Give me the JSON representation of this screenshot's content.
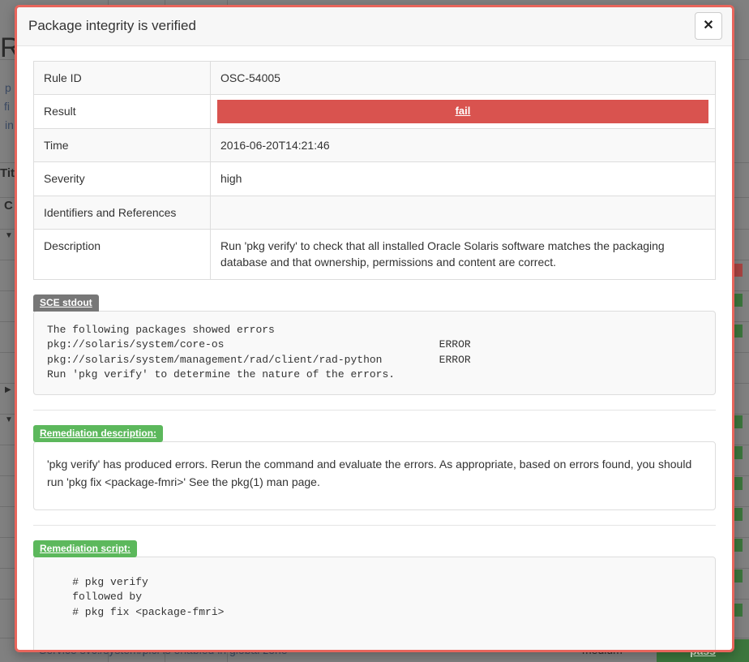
{
  "modal": {
    "title": "Package integrity is verified",
    "close_label": "✕",
    "close_icon": "close-icon"
  },
  "details": {
    "rows": [
      {
        "key": "Rule ID",
        "value": "OSC-54005",
        "type": "text"
      },
      {
        "key": "Result",
        "value": "fail",
        "type": "result",
        "color": "#d9534f"
      },
      {
        "key": "Time",
        "value": "2016-06-20T14:21:46",
        "type": "text"
      },
      {
        "key": "Severity",
        "value": "high",
        "type": "text"
      },
      {
        "key": "Identifiers and References",
        "value": "",
        "type": "text"
      },
      {
        "key": "Description",
        "value": "Run 'pkg verify' to check that all installed Oracle Solaris software matches the packaging database and that ownership, permissions and content are correct.",
        "type": "text"
      }
    ]
  },
  "sections": {
    "stdout": {
      "tag": "SCE stdout",
      "tag_color": "#777777",
      "content": "The following packages showed errors\npkg://solaris/system/core-os                                  ERROR\npkg://solaris/system/management/rad/client/rad-python         ERROR\nRun 'pkg verify' to determine the nature of the errors."
    },
    "remediation_description": {
      "tag": "Remediation description:",
      "tag_color": "#5cb85c",
      "content": "'pkg verify' has produced errors. Rerun the command and evaluate the errors. As appropriate, based on errors found, you should run 'pkg fix <package-fmri>' See the pkg(1) man page."
    },
    "remediation_script": {
      "tag": "Remediation script:",
      "tag_color": "#5cb85c",
      "content": "    # pkg verify\n    followed by\n    # pkg fix <package-fmri>"
    }
  },
  "background": {
    "page_title": "Ru",
    "fragments": [
      "p",
      "fi",
      "in"
    ],
    "labels": [
      "Titl",
      "C"
    ],
    "bottom_row": {
      "title": "Service svc:/system/picl is enabled in global zone",
      "severity": "medium",
      "result": "pass",
      "result_color": "#3c763d"
    }
  }
}
